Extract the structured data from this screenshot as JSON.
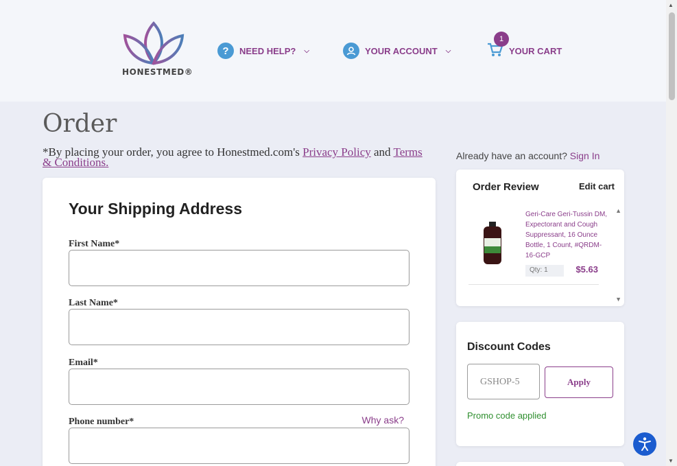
{
  "header": {
    "logo_text": "HONESTMED®",
    "need_help_label": "NEED HELP?",
    "account_label": "YOUR ACCOUNT",
    "cart_label": "YOUR CART",
    "cart_count": "1"
  },
  "page": {
    "title": "Order",
    "agree_prefix": "*By placing your order, you agree to Honestmed.com's",
    "privacy_link": "Privacy Policy",
    "agree_and": "and",
    "terms_link": "Terms & Conditions."
  },
  "shipping": {
    "title": "Your Shipping Address",
    "first_name_label": "First Name*",
    "first_name_value": "",
    "last_name_label": "Last Name*",
    "last_name_value": "",
    "email_label": "Email*",
    "email_value": "",
    "phone_label": "Phone number*",
    "phone_value": "",
    "why_ask": "Why ask?"
  },
  "account": {
    "prompt": "Already have an account?",
    "sign_in": "Sign In"
  },
  "order_review": {
    "title": "Order Review",
    "edit_cart": "Edit cart",
    "items": [
      {
        "name": "Geri-Care Geri-Tussin DM, Expectorant and Cough Suppressant, 16 Ounce Bottle, 1 Count, #QRDM-16-GCP",
        "qty_label": "Qty: 1",
        "price": "$5.63"
      }
    ]
  },
  "discount": {
    "title": "Discount Codes",
    "code_value": "GSHOP-5",
    "apply_label": "Apply",
    "status": "Promo code applied"
  },
  "colors": {
    "brand_purple": "#8a3d8a",
    "help_blue": "#4a9ad4",
    "success_green": "#2f8f2f",
    "access_blue": "#1b5ccf"
  }
}
